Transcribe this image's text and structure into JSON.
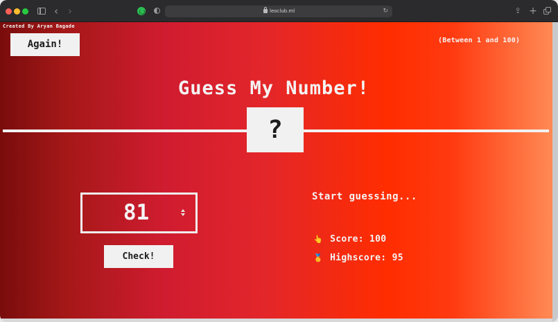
{
  "browser": {
    "url": "leoclub.ml"
  },
  "game": {
    "credit": "Created By Aryan Bagade",
    "again_label": "Again!",
    "range_hint": "(Between 1 and 100)",
    "title": "Guess My Number!",
    "secret": "?",
    "guess_value": "81",
    "check_label": "Check!",
    "message": "Start guessing...",
    "score_label": "Score:",
    "score_value": "100",
    "highscore_label": "Highscore:",
    "highscore_value": "95",
    "score_icon": "👆",
    "highscore_icon": "🥇"
  },
  "colors": {
    "gradient_left": "#7a0c0c",
    "gradient_mid": "#e3262a",
    "gradient_right": "#ff8a55",
    "button_bg": "#f1f1f1"
  }
}
